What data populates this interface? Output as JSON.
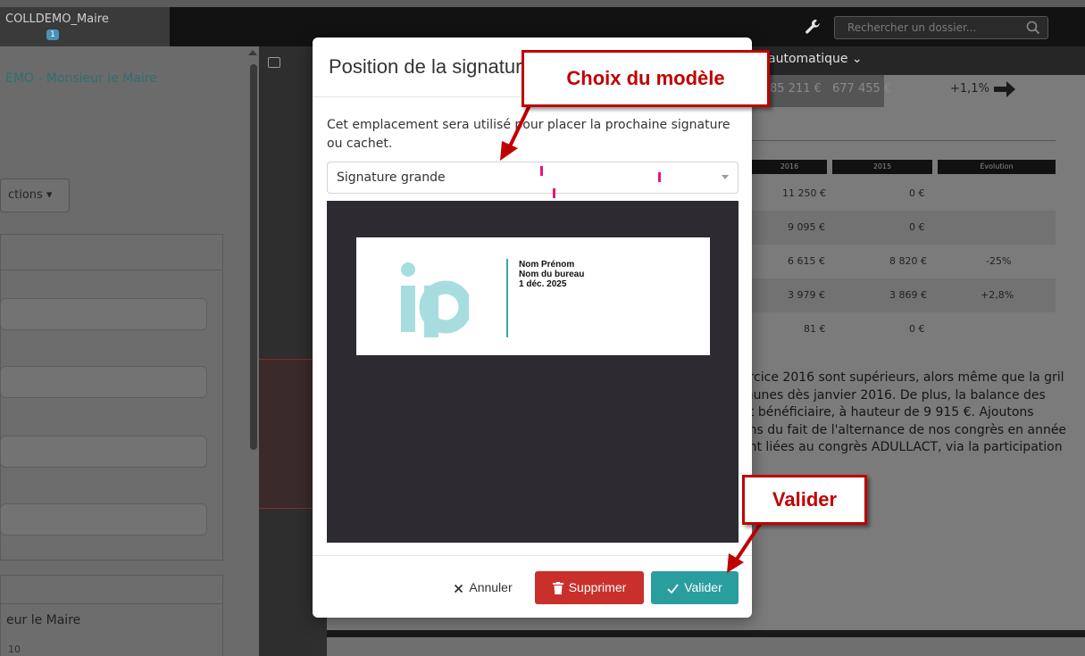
{
  "topbar": {
    "user_name": "COLLDEMO_Maire",
    "user_badge": "1",
    "search_placeholder": "Rechercher un dossier..."
  },
  "sidebar": {
    "breadcrumb": "EMO - Monsieur le Maire",
    "actions_label": "ctions ▾",
    "panel2_label": "eur le Maire",
    "panel2_number": "10"
  },
  "doc": {
    "mode_label": "automatique  ⌄",
    "stat_1": "85 211 €",
    "stat_2": "677 455 €",
    "stat_pct": "+1,1%",
    "table_headers": [
      "2016",
      "2015",
      "Évolution"
    ],
    "table_rows": [
      [
        "11 250 €",
        "0 €",
        ""
      ],
      [
        "9 095 €",
        "0 €",
        ""
      ],
      [
        "6 615 €",
        "8 820 €",
        "-25%"
      ],
      [
        "3 979 €",
        "3 869 €",
        "+2,8%"
      ],
      [
        "81 €",
        "0 €",
        ""
      ]
    ],
    "paragraph_lines": [
      "ercice 2016 sont supérieurs, alors même que la gril",
      "munes dès janvier 2016. De plus, la balance des",
      "nt bénéficiaire, à hauteur de 9 915 €.  Ajoutons",
      "ans du fait de l'alternance de nos congrès en année",
      "ent liées au congrès ADULLACT, via la participation"
    ]
  },
  "modal": {
    "title": "Position de la signature",
    "description": "Cet emplacement sera utilisé pour placer la prochaine signature ou cachet.",
    "select_value": "Signature grande",
    "signature_lines": [
      "Nom Prénom",
      "Nom du bureau",
      "1 déc. 2025"
    ],
    "cancel_label": "Annuler",
    "delete_label": "Supprimer",
    "validate_label": "Valider"
  },
  "callouts": {
    "model_choice": "Choix du modèle",
    "validate": "Valider"
  },
  "colors": {
    "accent_teal": "#2a9d9f",
    "danger_red": "#c9302c",
    "callout_red": "#c00000",
    "marker_pink": "#e8157f",
    "logo_light_teal": "#a8dde0"
  }
}
